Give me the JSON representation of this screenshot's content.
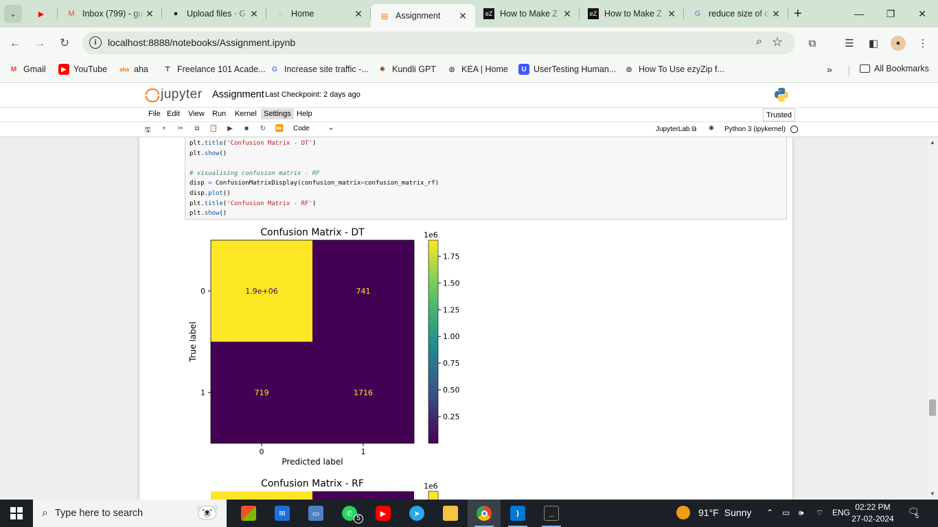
{
  "browser": {
    "tabs": [
      {
        "title": "",
        "icon": "youtube-icon"
      },
      {
        "title": "Inbox (799) - gu",
        "icon": "gmail-icon"
      },
      {
        "title": "Upload files · G",
        "icon": "github-icon"
      },
      {
        "title": "Home",
        "icon": "jupyter-icon"
      },
      {
        "title": "Assignment",
        "icon": "notebook-icon",
        "active": true
      },
      {
        "title": "How to Make Z",
        "icon": "ez-icon"
      },
      {
        "title": "How to Make Z",
        "icon": "ez-icon"
      },
      {
        "title": "reduce size of c",
        "icon": "google-icon"
      }
    ],
    "url": "localhost:8888/notebooks/Assignment.ipynb",
    "bookmarks": [
      {
        "label": "Gmail",
        "icon": "gmail-icon"
      },
      {
        "label": "YouTube",
        "icon": "youtube-icon"
      },
      {
        "label": "aha",
        "icon": "aha-icon"
      },
      {
        "label": "Freelance 101 Acade...",
        "icon": "freelance-icon"
      },
      {
        "label": "Increase site traffic -...",
        "icon": "google-icon"
      },
      {
        "label": "Kundli GPT",
        "icon": "kundli-icon"
      },
      {
        "label": "KEA | Home",
        "icon": "globe-icon"
      },
      {
        "label": "UserTesting Human...",
        "icon": "usertesting-icon"
      },
      {
        "label": "How To Use ezyZip f...",
        "icon": "globe-icon"
      }
    ],
    "all_bookmarks": "All Bookmarks",
    "overflow": "»"
  },
  "jupyter": {
    "logo_text": "jupyter",
    "notebook_name": "Assignment",
    "checkpoint": "Last Checkpoint: 2 days ago",
    "menu": [
      "File",
      "Edit",
      "View",
      "Run",
      "Kernel",
      "Settings",
      "Help"
    ],
    "trusted": "Trusted",
    "cell_type": "Code",
    "jupyterlab_link": "JupyterLab",
    "kernel": "Python 3 (ipykernel)"
  },
  "code_lines": [
    {
      "segments": [
        [
          "plt.",
          ""
        ],
        [
          "title",
          "attr"
        ],
        [
          "(",
          ""
        ],
        [
          "'Confusion Matrix - DT'",
          "str"
        ],
        [
          ")",
          ""
        ]
      ]
    },
    {
      "segments": [
        [
          "plt.",
          ""
        ],
        [
          "show",
          "attr"
        ],
        [
          "()",
          ""
        ]
      ]
    },
    {
      "segments": [
        [
          "",
          ""
        ]
      ]
    },
    {
      "segments": [
        [
          "# visualising confusion matrix - RF",
          "comment"
        ]
      ]
    },
    {
      "segments": [
        [
          "disp ",
          ""
        ],
        [
          "=",
          "op"
        ],
        [
          " ConfusionMatrixDisplay(confusion_matrix",
          ""
        ],
        [
          "=",
          "op"
        ],
        [
          "confusion_matrix_rf)",
          ""
        ]
      ]
    },
    {
      "segments": [
        [
          "disp.",
          ""
        ],
        [
          "plot",
          "attr"
        ],
        [
          "()",
          ""
        ]
      ]
    },
    {
      "segments": [
        [
          "plt.",
          ""
        ],
        [
          "title",
          "attr"
        ],
        [
          "(",
          ""
        ],
        [
          "'Confusion Matrix - RF'",
          "str"
        ],
        [
          ")",
          ""
        ]
      ]
    },
    {
      "segments": [
        [
          "plt.",
          ""
        ],
        [
          "show",
          "attr"
        ],
        [
          "()",
          ""
        ]
      ]
    }
  ],
  "chart_data": [
    {
      "type": "heatmap",
      "title": "Confusion Matrix - DT",
      "xlabel": "Predicted label",
      "ylabel": "True label",
      "x_ticks": [
        "0",
        "1"
      ],
      "y_ticks": [
        "0",
        "1"
      ],
      "cells": [
        {
          "row": 0,
          "col": 0,
          "label": "1.9e+06",
          "value": 1900000
        },
        {
          "row": 0,
          "col": 1,
          "label": "741",
          "value": 741
        },
        {
          "row": 1,
          "col": 0,
          "label": "719",
          "value": 719
        },
        {
          "row": 1,
          "col": 1,
          "label": "1716",
          "value": 1716
        }
      ],
      "colorbar": {
        "multiplier": "1e6",
        "ticks": [
          "1.75",
          "1.50",
          "1.25",
          "1.00",
          "0.75",
          "0.50",
          "0.25"
        ],
        "tick_values": [
          1.75,
          1.5,
          1.25,
          1.0,
          0.75,
          0.5,
          0.25
        ],
        "range": [
          0,
          1.9
        ]
      },
      "colors": {
        "high": "#fde725",
        "low": "#440154",
        "high_text": "#440154",
        "low_text": "#fde725"
      }
    },
    {
      "type": "heatmap",
      "title": "Confusion Matrix - RF",
      "colorbar": {
        "multiplier": "1e6"
      },
      "partial": true
    }
  ],
  "taskbar": {
    "search_placeholder": "Type here to search",
    "weather_temp": "91°F",
    "weather_desc": "Sunny",
    "lang": "ENG",
    "time": "02:22 PM",
    "date": "27-02-2024",
    "whatsapp_badge": "5",
    "notif_count": "5"
  }
}
